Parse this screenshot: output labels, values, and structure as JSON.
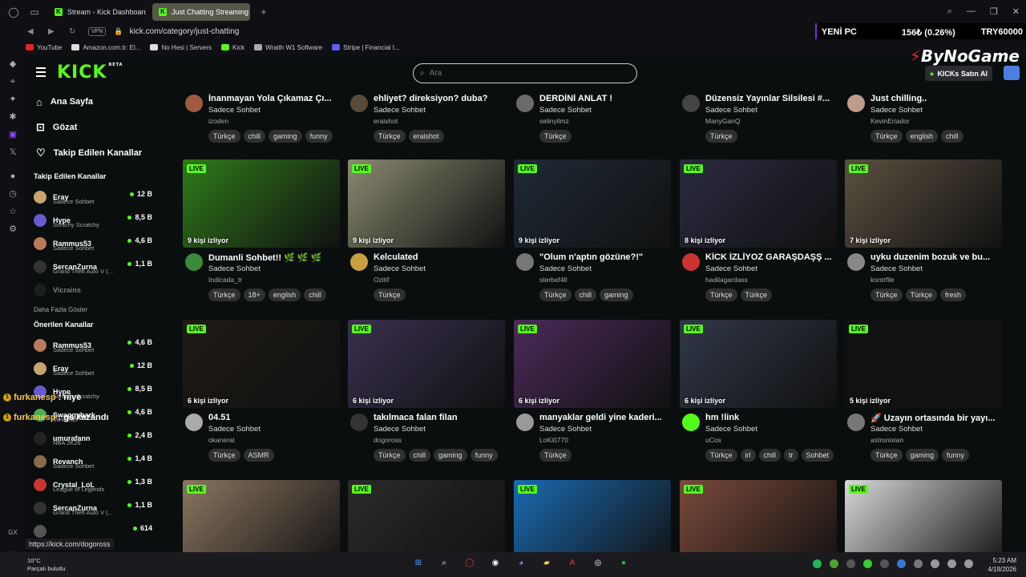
{
  "browser": {
    "tabs": [
      {
        "label": "Stream - Kick Dashboard",
        "active": false
      },
      {
        "label": "Just Chatting Streaming -",
        "active": true
      }
    ],
    "url": "kick.com/category/just-chatting",
    "vpn": "VPN",
    "status_url": "https://kick.com/dogoross",
    "bookmarks": [
      {
        "label": "YouTube",
        "color": "#e02424"
      },
      {
        "label": "Amazon.com.tr: El...",
        "color": "#ddd"
      },
      {
        "label": "No Hesi | Servers",
        "color": "#ddd"
      },
      {
        "label": "Kick",
        "color": "#53fc18"
      },
      {
        "label": "Wraith W1 Software",
        "color": "#aaa"
      },
      {
        "label": "Stripe | Financial I...",
        "color": "#635bff"
      }
    ]
  },
  "ticker": {
    "label": "YENİ PC",
    "delta": "156₺ (0.26%)",
    "price": "TRY60000"
  },
  "header": {
    "logo": "KICK",
    "logo_sup": "BETA",
    "search_placeholder": "Ara",
    "brand_a": "ByNoGame",
    "buy_label": "KICKs Satın Al"
  },
  "sidebar": {
    "nav": [
      {
        "icon": "home-icon",
        "label": "Ana Sayfa"
      },
      {
        "icon": "compass-icon",
        "label": "Gözat"
      },
      {
        "icon": "heart-icon",
        "label": "Takip Edilen Kanallar"
      }
    ],
    "followed_title": "Takip Edilen Kanallar",
    "followed": [
      {
        "name": "Eray",
        "cat": "Sadece Sohbet",
        "viewers": "12 B",
        "color": "#c8a46e"
      },
      {
        "name": "Hype",
        "cat": "Scritchy Scratchy",
        "viewers": "8,5 B",
        "color": "#6a5acd"
      },
      {
        "name": "Rammus53",
        "cat": "Sadece Sohbet",
        "viewers": "4,6 B",
        "color": "#b87a5a"
      },
      {
        "name": "SercanZurna",
        "cat": "Grand Theft Auto V (...",
        "viewers": "1,1 B",
        "color": "#333"
      }
    ],
    "offline": "Vicrains",
    "more": "Daha Fazla Göster",
    "suggested_title": "Önerilen Kanallar",
    "suggested": [
      {
        "name": "Rammus53",
        "cat": "Sadece Sohbet",
        "viewers": "4,6 B",
        "color": "#b87a5a"
      },
      {
        "name": "Eray",
        "cat": "Sadece Sohbet",
        "viewers": "12 B",
        "color": "#c8a46e"
      },
      {
        "name": "Hype",
        "cat": "Scritchy Scratchy",
        "viewers": "8,5 B",
        "color": "#6a5acd"
      },
      {
        "name": "Swaggybark",
        "cat": "Minecraft",
        "viewers": "4,6 B",
        "color": "#4caf50"
      },
      {
        "name": "umurafann",
        "cat": "NBA 2K26",
        "viewers": "2,4 B",
        "color": "#222"
      },
      {
        "name": "Revanch",
        "cat": "Sadece Sohbet",
        "viewers": "1,4 B",
        "color": "#8a6a4a"
      },
      {
        "name": "Crystal_LoL",
        "cat": "League of Legends",
        "viewers": "1,3 B",
        "color": "#c33"
      },
      {
        "name": "SercanZurna",
        "cat": "Grand Theft Auto V (...",
        "viewers": "1,1 B",
        "color": "#333"
      },
      {
        "name": "",
        "cat": "",
        "viewers": "614",
        "color": "#555"
      }
    ]
  },
  "chat_overlay": [
    {
      "user": "furkanesp",
      "msg": ": niye"
    },
    {
      "user": "furkanesp",
      "msg": ": gs kazandı"
    }
  ],
  "rows": [
    [
      {
        "title": "İnanmayan Yola Çıkamaz Çı...",
        "cat": "Sadece Sohbet",
        "user": "izoden",
        "tags": [
          "Türkçe",
          "chill",
          "gaming",
          "funny"
        ],
        "color": "#a05a40"
      },
      {
        "title": "ehliyet? direksiyon? duba?",
        "cat": "Sadece Sohbet",
        "user": "eraishot",
        "tags": [
          "Türkçe",
          "eraishot"
        ],
        "color": "#5a4a3a"
      },
      {
        "title": "DERDİNİ ANLAT !",
        "cat": "Sadece Sohbet",
        "user": "selinyilmz",
        "tags": [
          "Türkçe"
        ],
        "color": "#6a6a6a"
      },
      {
        "title": "Düzensiz Yayınlar Silsilesi #...",
        "cat": "Sadece Sohbet",
        "user": "ManyGanQ",
        "tags": [
          "Türkçe"
        ],
        "color": "#444"
      },
      {
        "title": "Just chilling..",
        "cat": "Sadece Sohbet",
        "user": "KevinEriador",
        "tags": [
          "Türkçe",
          "english",
          "chill"
        ],
        "color": "#c09a8a"
      }
    ],
    [
      {
        "title": "Dumanli Sohbet!! 🌿 🌿 🌿",
        "cat": "Sadece Sohbet",
        "user": "Indicada_tr",
        "tags": [
          "Türkçe",
          "18+",
          "english",
          "chill"
        ],
        "viewers": "9 kişi izliyor",
        "color": "#3a8a3a",
        "bg": "#2f7a1a"
      },
      {
        "title": "Kelculated",
        "cat": "Sadece Sohbet",
        "user": "Ozitif",
        "tags": [
          "Türkçe"
        ],
        "viewers": "9 kişi izliyor",
        "color": "#c8a040",
        "bg": "#8a8a70"
      },
      {
        "title": "\"Olum n'aptın gözüne?!\"",
        "cat": "Sadece Sohbet",
        "user": "sterbef4ll",
        "tags": [
          "Türkçe",
          "chill",
          "gaming"
        ],
        "viewers": "9 kişi izliyor",
        "color": "#777",
        "bg": "#1e2a36"
      },
      {
        "title": "KİCK İZLİYOZ GARAŞDAŞŞ ...",
        "cat": "Sadece Sohbet",
        "user": "hadilagardass",
        "tags": [
          "Türkçe",
          "Türkçe"
        ],
        "viewers": "8 kişi izliyor",
        "color": "#c33",
        "bg": "#2a2a40"
      },
      {
        "title": "uyku duzenim bozuk ve bu...",
        "cat": "Sadece Sohbet",
        "user": "kontrfile",
        "tags": [
          "Türkçe",
          "Türkçe",
          "fresh"
        ],
        "viewers": "7 kişi izliyor",
        "color": "#888",
        "bg": "#5a5040"
      }
    ],
    [
      {
        "title": "04.51",
        "cat": "Sadece Sohbet",
        "user": "okaneral",
        "tags": [
          "Türkçe",
          "ASMR"
        ],
        "viewers": "6 kişi izliyor",
        "color": "#aaa",
        "bg": "#1e1a14"
      },
      {
        "title": "takılmaca falan filan",
        "cat": "Sadece Sohbet",
        "user": "dogoross",
        "tags": [
          "Türkçe",
          "chill",
          "gaming",
          "funny"
        ],
        "viewers": "6 kişi izliyor",
        "color": "#333",
        "bg": "#3a3050"
      },
      {
        "title": "manyaklar geldi yine kaderi...",
        "cat": "Sadece Sohbet",
        "user": "LoKi0770",
        "tags": [
          "Türkçe"
        ],
        "viewers": "6 kişi izliyor",
        "color": "#999",
        "bg": "#4a2a5a"
      },
      {
        "title": "hm !link",
        "cat": "Sadece Sohbet",
        "user": "uCos",
        "tags": [
          "Türkçe",
          "irl",
          "chill",
          "tr",
          "Sohbet"
        ],
        "viewers": "6 kişi izliyor",
        "color": "#53fc18",
        "bg": "#303848"
      },
      {
        "title": "🚀 Uzayın ortasında bir yayı...",
        "cat": "Sadece Sohbet",
        "user": "astronixian",
        "tags": [
          "Türkçe",
          "gaming",
          "funny"
        ],
        "viewers": "5 kişi izliyor",
        "color": "#777",
        "bg": "#111"
      }
    ],
    [
      {
        "bg": "#8a7660"
      },
      {
        "bg": "#2a2a2a"
      },
      {
        "bg": "#1a6ab0"
      },
      {
        "bg": "#7a4a3a"
      },
      {
        "bg": "#d8d8d8"
      }
    ]
  ],
  "live_label": "LIVE",
  "taskbar": {
    "temp": "10°C",
    "weather": "Parçalı bulutlu",
    "time": "5:23 AM",
    "date": "4/19/2026"
  }
}
